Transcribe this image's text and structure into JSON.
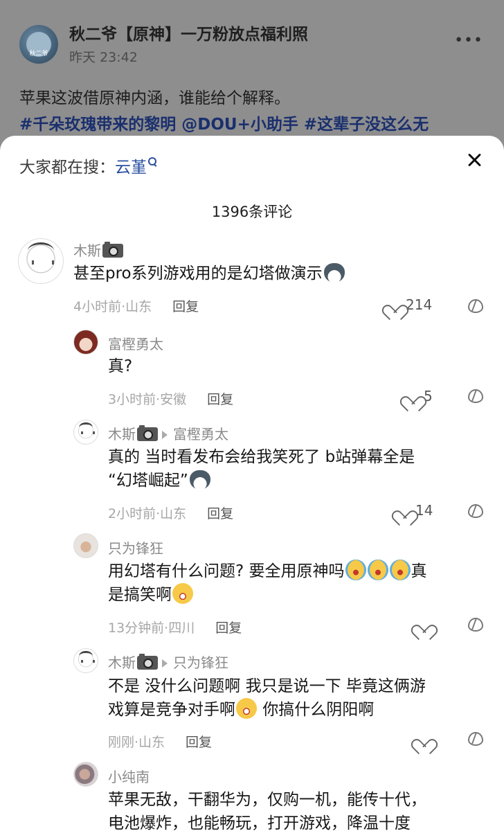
{
  "post": {
    "author": "秋二爷【原神】一万粉放点福利照",
    "avatar_text": "秋二爷",
    "time": "昨天 23:42",
    "more": "•••",
    "text": "苹果这波借原神内涵，谁能给个解释。",
    "tags": "#千朵玫瑰带来的黎明 @DOU+小助手 #这辈子没这么无"
  },
  "sheet": {
    "search_label": "大家都在搜：",
    "search_term": "云堇",
    "comment_count": "1396条评论"
  },
  "comments": [
    {
      "user": "木斯",
      "text": "甚至pro系列游戏用的是幻塔做演示",
      "time_loc": "4小时前·山东",
      "reply": "回复",
      "likes": "214"
    },
    {
      "user": "富樫勇太",
      "text": "真?",
      "time_loc": "3小时前·安徽",
      "reply": "回复",
      "likes": "5"
    },
    {
      "user": "木斯",
      "reply_to": "富樫勇太",
      "text_line1": "真的 当时看发布会给我笑死了 b站弹幕全是",
      "text_line2": "“幻塔崛起”",
      "time_loc": "2小时前·山东",
      "reply": "回复",
      "likes": "14"
    },
    {
      "user": "只为锋狂",
      "text_line1": "用幻塔有什么问题? 要全用原神吗",
      "text_line1_tail": "真",
      "text_line2": "是搞笑啊",
      "time_loc": "13分钟前·四川",
      "reply": "回复",
      "likes": ""
    },
    {
      "user": "木斯",
      "reply_to": "只为锋狂",
      "text_line1": "不是 没什么问题啊 我只是说一下 毕竟这俩游",
      "text_line2": "戏算是竞争对手啊",
      "text_line2_tail": " 你搞什么阴阳啊",
      "time_loc": "刚刚·山东",
      "reply": "回复",
      "likes": ""
    },
    {
      "user": "小纯南",
      "text_line1": "苹果无敌，干翻华为，仅购一机，能传十代，",
      "text_line2": "电池爆炸，也能畅玩，打开游戏，降温十度"
    }
  ]
}
